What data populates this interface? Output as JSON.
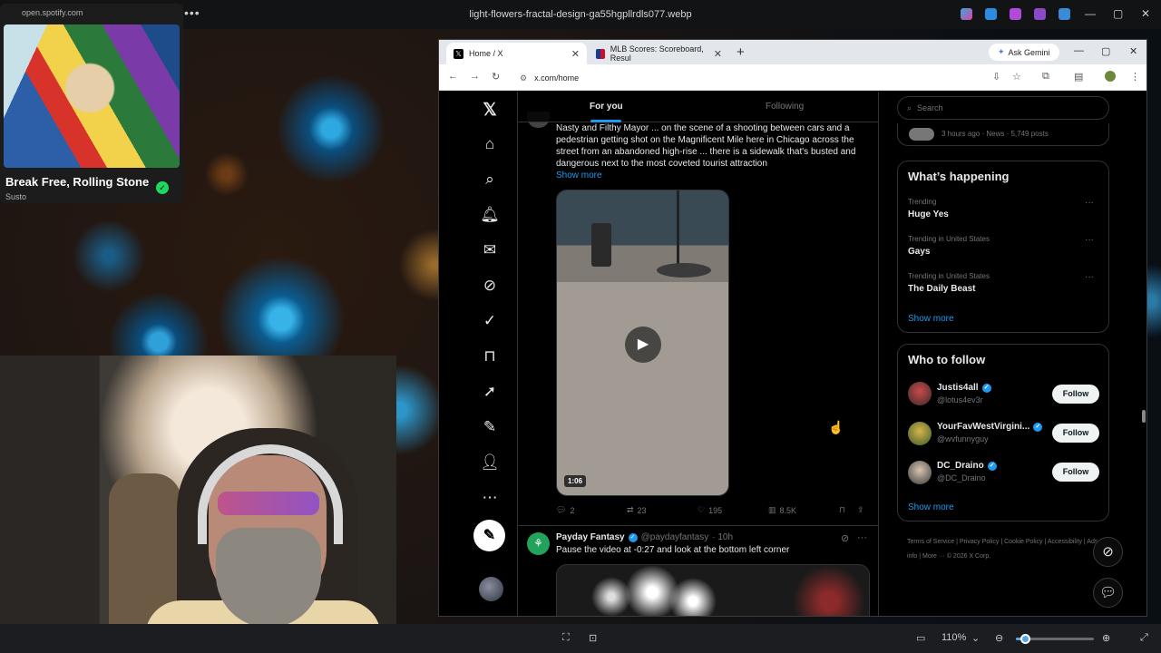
{
  "viewer": {
    "file_title": "light-flowers-fractal-design-ga55hgpllrdls077.webp",
    "menu_dots": "•••",
    "zoom": "110%",
    "zoom_fraction": 0.12
  },
  "spotify": {
    "url": "open.spotify.com",
    "track": "Break Free, Rolling Stone",
    "artist": "Susto",
    "check": "✓"
  },
  "browser": {
    "tabs": [
      {
        "label": "Home / X",
        "close": "✕"
      },
      {
        "label": "MLB Scores: Scoreboard, Resul",
        "close": "✕"
      }
    ],
    "new_tab": "+",
    "gemini": "Ask Gemini",
    "url": "x.com/home"
  },
  "x": {
    "feed_tabs": [
      "For you",
      "Following"
    ],
    "tweet1": {
      "text": "Nasty and Filthy Mayor ... on the scene of a shooting between cars and a pedestrian getting shot on the Magnificent Mile here in Chicago across the street from an abandoned high-rise ... there is a sidewalk that's busted and dangerous next to the most coveted tourist attraction",
      "show_more": "Show more",
      "duration": "1:06",
      "replies": "2",
      "reposts": "23",
      "likes": "195",
      "views": "8.5K"
    },
    "tweet2": {
      "name": "Payday Fantasy",
      "handle": "@paydayfantasy",
      "time": "· 10h",
      "text": "Pause the video at -0:27 and look at the bottom left corner"
    },
    "search_placeholder": "Search",
    "news_meta": "3 hours ago · News · 5,749 posts",
    "happening": {
      "title": "What’s happening",
      "trends": [
        {
          "context": "Trending",
          "name": "Huge Yes"
        },
        {
          "context": "Trending in United States",
          "name": "Gays"
        },
        {
          "context": "Trending in United States",
          "name": "The Daily Beast"
        }
      ],
      "show_more": "Show more"
    },
    "who_to_follow": {
      "title": "Who to follow",
      "accounts": [
        {
          "name": "Justis4all",
          "handle": "@lotus4ev3r",
          "button": "Follow"
        },
        {
          "name": "YourFavWestVirgini...",
          "handle": "@wvfunnyguy",
          "button": "Follow"
        },
        {
          "name": "DC_Draino",
          "handle": "@DC_Draino",
          "button": "Follow"
        }
      ],
      "show_more": "Show more"
    },
    "footer": "Terms of Service  |  Privacy Policy  |  Cookie Policy  |  Accessibility  |  Ads info  |  More ···  © 2026 X Corp."
  },
  "colors": {
    "accent": "#1d9bf0",
    "background": "#000000",
    "spotify_green": "#1ed760"
  }
}
